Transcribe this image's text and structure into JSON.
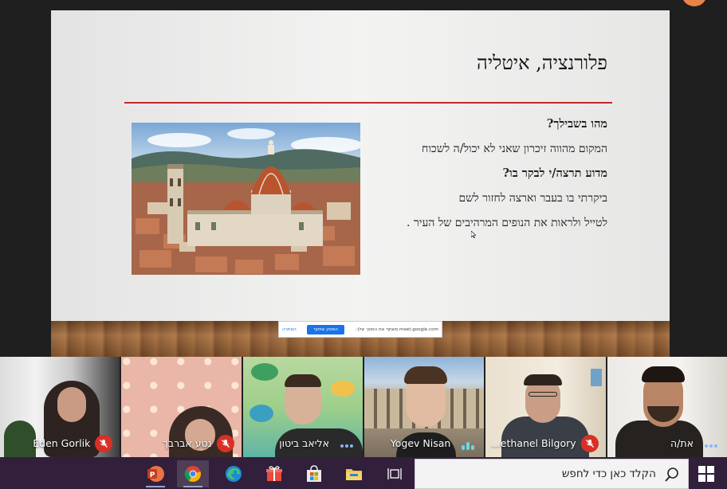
{
  "slide": {
    "title": "פלורנציה, איטליה",
    "lines": [
      "מהו בשבילך?",
      "המקום מהווה זיכרון שאני לא יכול/ה לשכוח",
      "מדוע תרצה/י  לבקר בו?",
      "ביקרתי בו בעבר וארצה לחזור לשם",
      "לטייל ולראות את הנופים המרהיבים של העיר ."
    ],
    "accent_color": "#c4262e"
  },
  "share_bar": {
    "message": "meet.google.com משתף את המסך שלך.",
    "stop_label": "הפסק שיתוף",
    "hide_label": "הסתרה"
  },
  "participants": [
    {
      "name": "Eden Gorlik",
      "status": "mic-off"
    },
    {
      "name": "נטע אברבך",
      "status": "mic-off"
    },
    {
      "name": "אליאב ביטון",
      "status": "more"
    },
    {
      "name": "Yogev Nisan",
      "status": "speaking"
    },
    {
      "name": "...ethanel Bilgory",
      "status": "mic-off"
    },
    {
      "name": "את/ה",
      "status": "more"
    }
  ],
  "taskbar": {
    "apps": [
      "powerpoint-icon",
      "chrome-icon",
      "edge-icon",
      "gift-icon",
      "store-icon",
      "file-explorer-icon",
      "task-view-icon"
    ],
    "search_placeholder": "הקלד כאן כדי לחפש"
  }
}
